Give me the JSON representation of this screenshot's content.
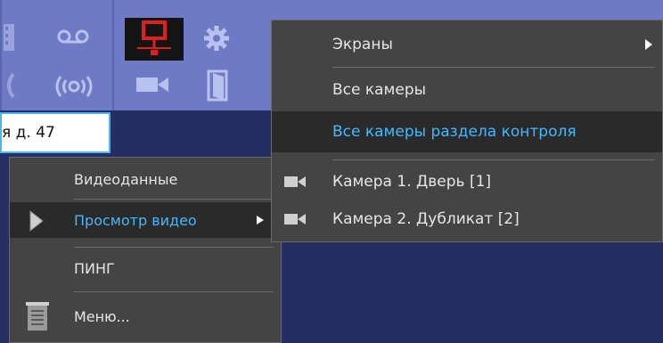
{
  "toolbar": {
    "icons": [
      "monitor-network-icon",
      "gear-icon",
      "voicemail-icon",
      "broadcast-icon",
      "video-camera-icon",
      "door-icon"
    ]
  },
  "address": {
    "text": "я д. 47"
  },
  "left_menu": {
    "items": [
      {
        "label": "Видеоданные"
      },
      {
        "label": "Просмотр видео"
      },
      {
        "label": "ПИНГ"
      },
      {
        "label": "Меню..."
      }
    ]
  },
  "right_menu": {
    "items": [
      {
        "label": "Экраны"
      },
      {
        "label": "Все камеры"
      },
      {
        "label": "Все камеры раздела контроля"
      },
      {
        "label": "Камера 1. Дверь [1]"
      },
      {
        "label": "Камера 2. Дубликат [2]"
      }
    ]
  },
  "colors": {
    "highlight_text": "#41b9ff",
    "toolbar": "#6e7ac3",
    "menu_bg": "#444444"
  }
}
